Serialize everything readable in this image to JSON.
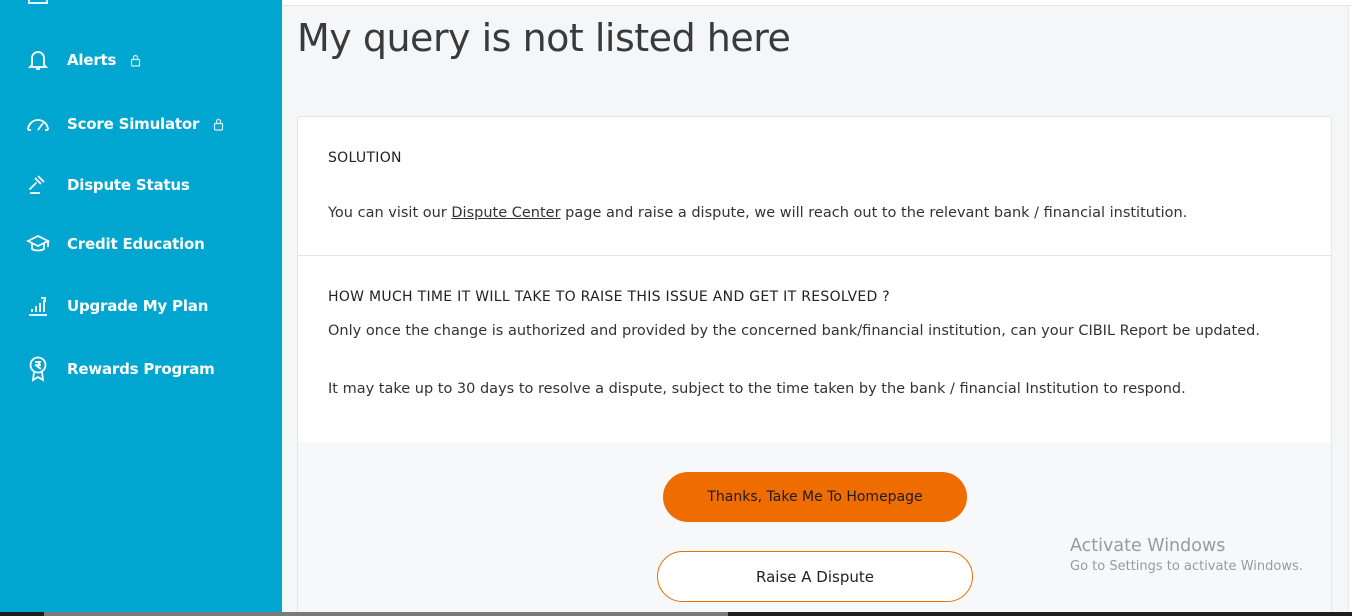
{
  "sidebar": {
    "items": [
      {
        "label": "Alerts",
        "icon": "bell-icon",
        "locked": true
      },
      {
        "label": "Score Simulator",
        "icon": "speedometer-icon",
        "locked": true
      },
      {
        "label": "Dispute Status",
        "icon": "gavel-icon",
        "locked": false
      },
      {
        "label": "Credit Education",
        "icon": "graduation-cap-icon",
        "locked": false
      },
      {
        "label": "Upgrade My Plan",
        "icon": "bar-chart-icon",
        "locked": false
      },
      {
        "label": "Rewards Program",
        "icon": "rupee-badge-icon",
        "locked": false
      }
    ],
    "background": "#00a6cf"
  },
  "main": {
    "title": "My query is not listed here",
    "solution": {
      "heading": "SOLUTION",
      "text_before": "You can visit our ",
      "link": "Dispute Center",
      "text_after": " page and raise a dispute, we will reach out to the relevant bank / financial institution."
    },
    "resolution": {
      "heading": "HOW MUCH TIME IT WILL TAKE TO RAISE THIS ISSUE AND GET IT RESOLVED ?",
      "para1": "Only once the change is authorized and provided by the concerned bank/financial institution, can your CIBIL Report be updated.",
      "para2": "It may take up to 30 days to resolve a dispute, subject to the time taken by the bank / financial Institution to respond."
    },
    "buttons": {
      "primary": "Thanks, Take Me To Homepage",
      "secondary": "Raise A Dispute"
    },
    "accent": "#ef6c00"
  },
  "watermark": {
    "line1": "Activate Windows",
    "line2": "Go to Settings to activate Windows."
  }
}
